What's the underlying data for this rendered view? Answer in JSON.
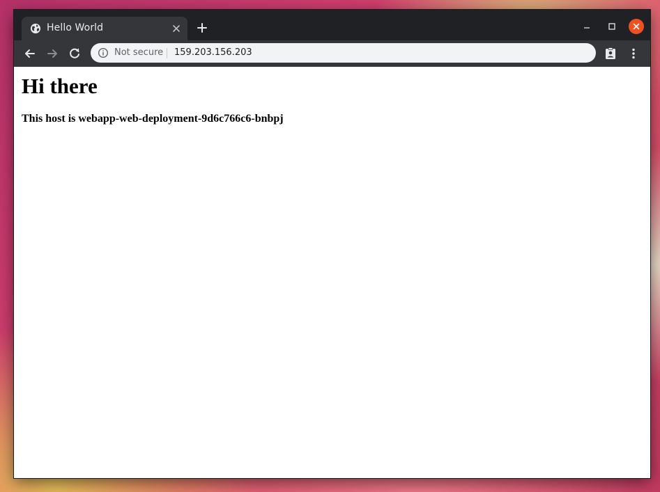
{
  "browser": {
    "tab": {
      "title": "Hello World",
      "favicon": "globe-icon"
    },
    "omnibox": {
      "security_label": "Not secure",
      "url": "159.203.156.203"
    },
    "icons": {
      "back": "arrow-left-icon",
      "forward": "arrow-right-icon",
      "reload": "reload-icon",
      "new_tab": "plus-icon",
      "extension": "clipboard-account-icon",
      "menu": "vertical-dots-icon"
    },
    "colors": {
      "titlebar": "#202124",
      "toolbar": "#35363a",
      "omnibox": "#f1f3f4",
      "close_button": "#f0501f"
    }
  },
  "page": {
    "heading": "Hi there",
    "host_line": "This host is webapp-web-deployment-9d6c766c6-bnbpj"
  }
}
